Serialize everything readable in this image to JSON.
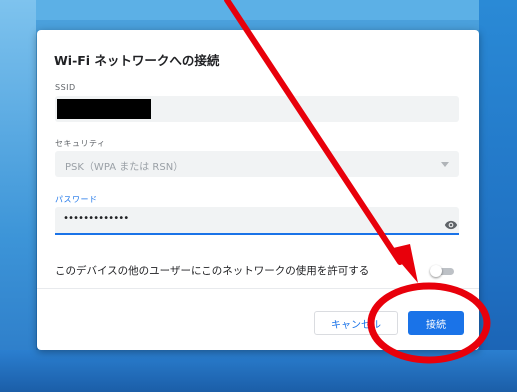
{
  "dialog": {
    "title": "Wi-Fi ネットワークへの接続",
    "ssid_label": "SSID",
    "security_label": "セキュリティ",
    "security_value": "PSK（WPA または RSN）",
    "password_label": "パスワード",
    "password_value": "•••••••••••••",
    "share_text": "このデバイスの他のユーザーにこのネットワークの使用を許可する",
    "share_enabled": false,
    "cancel_label": "キャンセル",
    "connect_label": "接続"
  },
  "colors": {
    "accent": "#1a73e8",
    "annotation_red": "#e8000b"
  },
  "icons": {
    "password_toggle": "eye-icon",
    "select_caret": "caret-down-icon"
  }
}
